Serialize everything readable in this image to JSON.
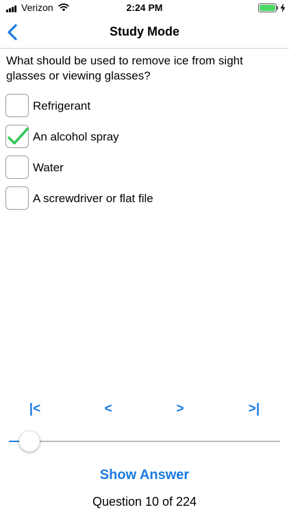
{
  "status_bar": {
    "carrier": "Verizon",
    "time": "2:24 PM",
    "battery_color": "#4cd964",
    "icons": [
      "signal-icon",
      "wifi-icon",
      "battery-icon",
      "charging-icon"
    ]
  },
  "nav": {
    "title": "Study Mode",
    "back_icon": "chevron-left-icon"
  },
  "question": {
    "text": "What should be used to remove ice from sight glasses or viewing glasses?"
  },
  "options": [
    {
      "label": "Refrigerant",
      "checked": false
    },
    {
      "label": "An alcohol spray",
      "checked": true
    },
    {
      "label": "Water",
      "checked": false
    },
    {
      "label": "A screwdriver or flat file",
      "checked": false
    }
  ],
  "pager": {
    "first": "|<",
    "prev": "<",
    "next": ">",
    "last": ">|"
  },
  "slider": {
    "value": 10,
    "min": 1,
    "max": 224
  },
  "show_answer_label": "Show Answer",
  "counter": "Question 10 of 224",
  "colors": {
    "accent": "#1a7ae0",
    "check": "#34c759"
  }
}
